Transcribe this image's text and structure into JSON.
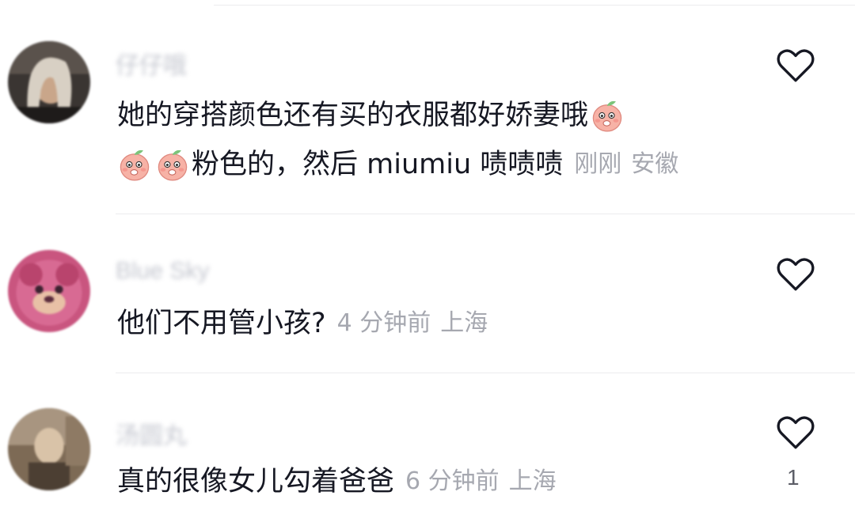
{
  "comments": [
    {
      "username": "仔仔哦",
      "text_line1": "她的穿搭颜色还有买的衣服都好娇妻哦",
      "text_line2": "粉色的，然后 miumiu 啧啧啧",
      "time": "刚刚",
      "location": "安徽",
      "emoji": "peach-emoji",
      "like_icon": "heart-outline-icon",
      "like_count": ""
    },
    {
      "username": "Blue Sky",
      "text_line1": "他们不用管小孩?",
      "time": "4 分钟前",
      "location": "上海",
      "like_icon": "heart-outline-icon",
      "like_count": ""
    },
    {
      "username": "汤圆丸",
      "text_line1": "真的很像女儿勾着爸爸",
      "time": "6 分钟前",
      "location": "上海",
      "like_icon": "heart-outline-icon",
      "like_count": "1"
    }
  ],
  "colors": {
    "text": "#161823",
    "meta": "#a6a8b0",
    "divider": "#ececee",
    "emoji_peach": "#f6a9a0"
  }
}
